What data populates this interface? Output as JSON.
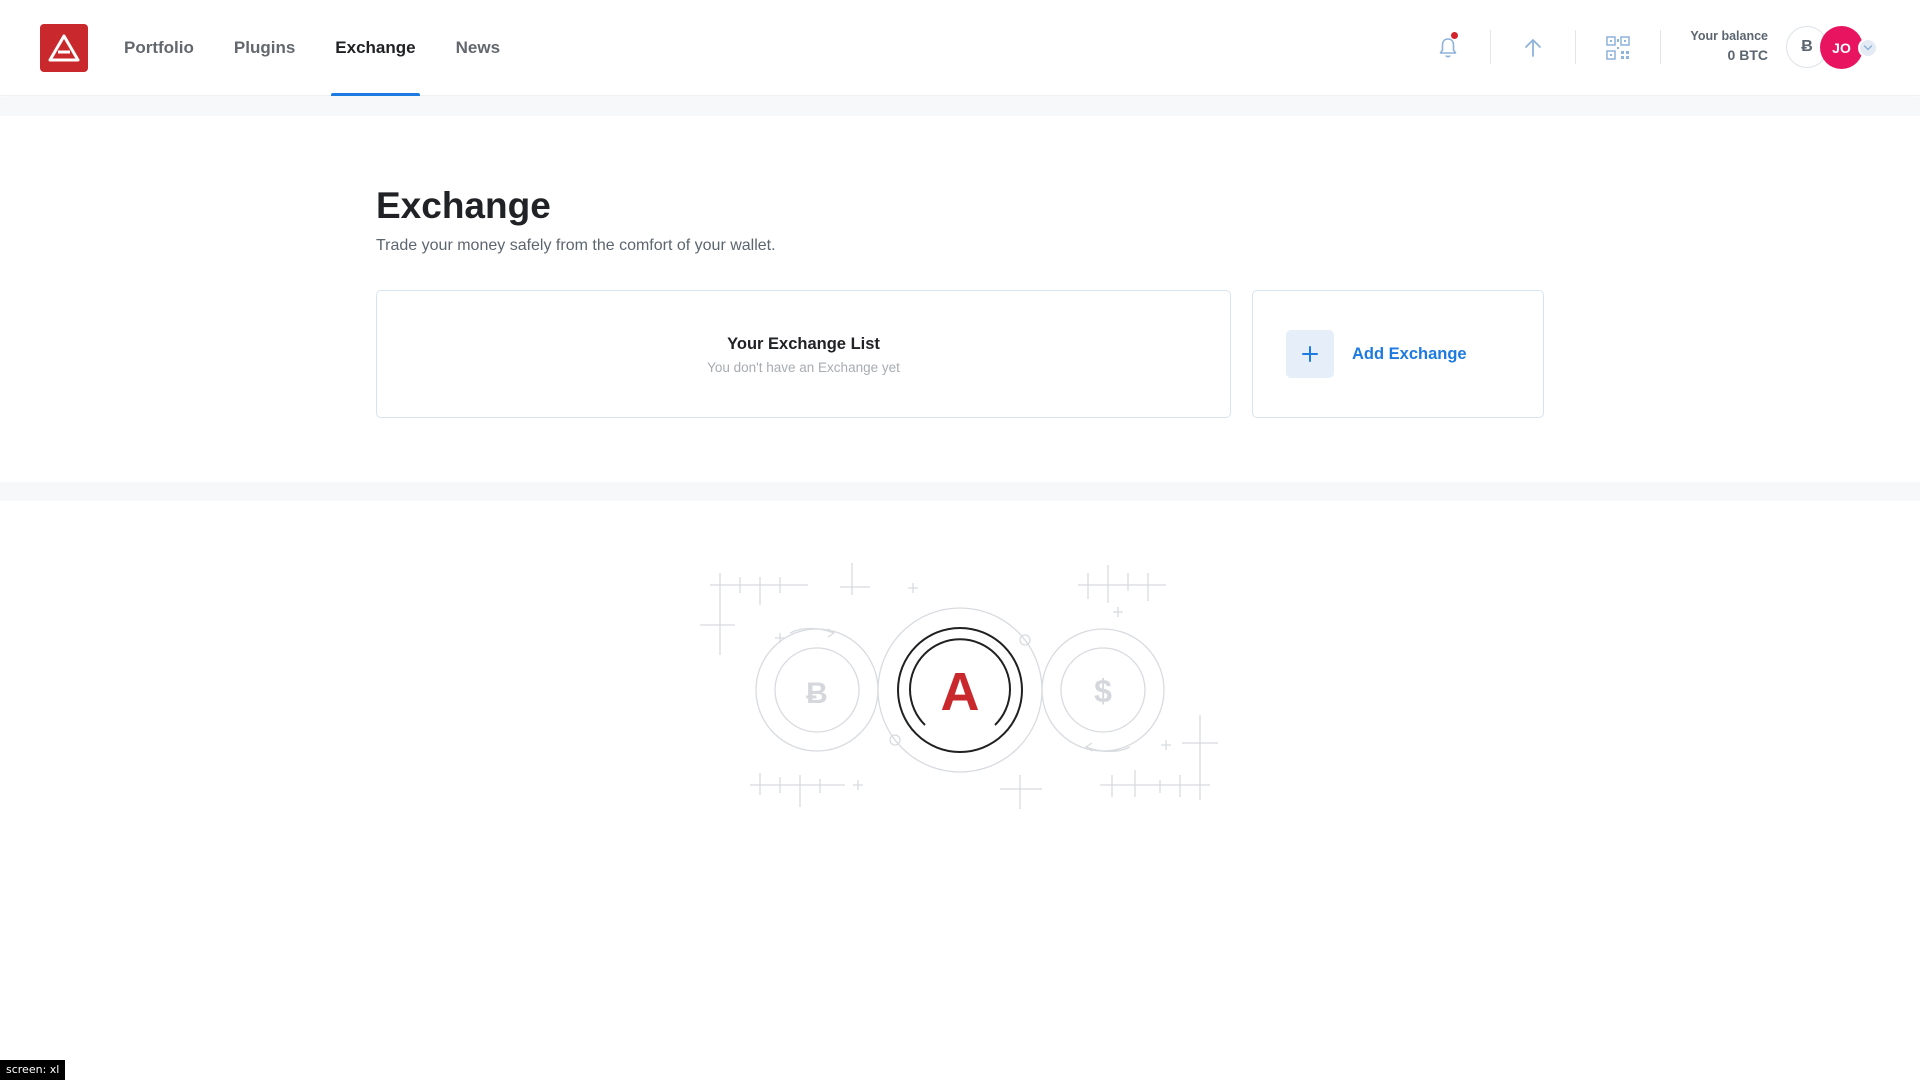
{
  "nav": {
    "items": [
      {
        "label": "Portfolio"
      },
      {
        "label": "Plugins"
      },
      {
        "label": "Exchange"
      },
      {
        "label": "News"
      }
    ],
    "active": "Exchange"
  },
  "header": {
    "balance_label": "Your balance",
    "balance_value": "0 BTC",
    "currency_symbol": "Ƀ",
    "avatar_initials": "JO",
    "icons": [
      "notification-bell-icon",
      "send-arrow-up-icon",
      "qr-code-icon",
      "chevron-down-icon"
    ],
    "has_unread_notifications": true
  },
  "main": {
    "title": "Exchange",
    "subtitle": "Trade your money safely from the comfort of your wallet.",
    "exchange_list": {
      "title": "Your Exchange List",
      "empty_text": "You don't have an Exchange yet"
    },
    "add_exchange_label": "Add Exchange"
  },
  "illustration": {
    "center_letter": "A",
    "left_symbol": "Ƀ",
    "right_symbol": "$"
  },
  "screen_badge": "screen: xl",
  "colors": {
    "brand_red": "#c9292c",
    "accent_blue": "#1d7ae0",
    "avatar_pink": "#e8145f",
    "notification_red": "#d3232c"
  }
}
